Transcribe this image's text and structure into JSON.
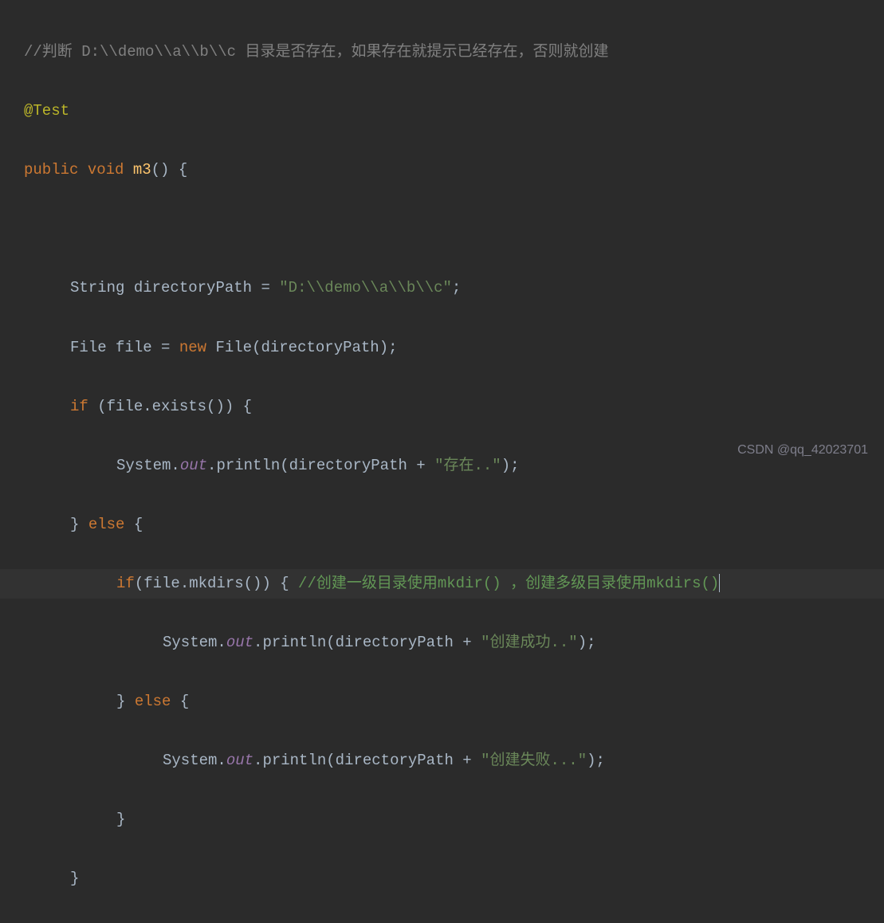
{
  "code": {
    "line1_comment": "//判断 D:\\\\demo\\\\a\\\\b\\\\c 目录是否存在，如果存在就提示已经存在，否则就创建",
    "line2_annotation": "@Test",
    "line3_kw1": "public",
    "line3_kw2": "void",
    "line3_method": "m3",
    "line3_rest": "() {",
    "line5_type": "String",
    "line5_var": "directoryPath",
    "line5_eq": " = ",
    "line5_str": "\"D:\\\\demo\\\\a\\\\b\\\\c\"",
    "line5_semi": ";",
    "line6_type": "File",
    "line6_var": "file",
    "line6_eq": " = ",
    "line6_kw": "new",
    "line6_ctor": " File(directoryPath)",
    "line6_semi": ";",
    "line7_kw": "if",
    "line7_cond": " (file.exists()) {",
    "line8_sys": "System.",
    "line8_out": "out",
    "line8_print": ".println(directoryPath + ",
    "line8_str": "\"存在..\"",
    "line8_end": ");",
    "line9_brace": "} ",
    "line9_kw": "else",
    "line9_rest": " {",
    "line10_kw": "if",
    "line10_cond": "(file.mkdirs()) { ",
    "line10_comment": "//创建一级目录使用mkdir() ，创建多级目录使用mkdirs()",
    "line11_sys": "System.",
    "line11_out": "out",
    "line11_print": ".println(directoryPath + ",
    "line11_str": "\"创建成功..\"",
    "line11_end": ");",
    "line12_brace": "} ",
    "line12_kw": "else",
    "line12_rest": " {",
    "line13_sys": "System.",
    "line13_out": "out",
    "line13_print": ".println(directoryPath + ",
    "line13_str": "\"创建失败...\"",
    "line13_end": ");",
    "line14_brace": "}",
    "line15_brace": "}"
  },
  "watermark": "CSDN @qq_42023701"
}
